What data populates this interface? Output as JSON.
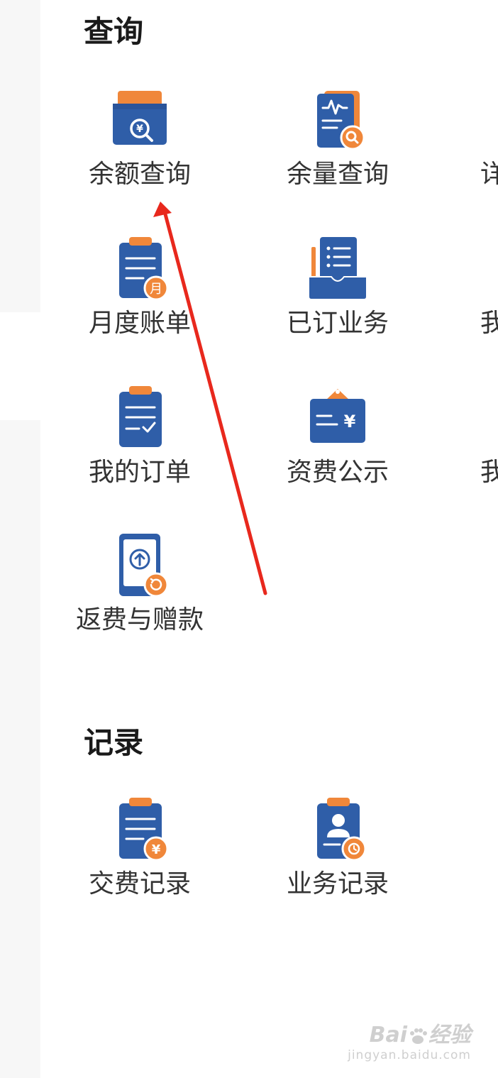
{
  "sections": [
    {
      "title": "查询"
    },
    {
      "title": "记录"
    }
  ],
  "query_items": [
    {
      "label": "余额查询",
      "icon": "wallet-yuan-search-icon"
    },
    {
      "label": "余量查询",
      "icon": "document-chart-search-icon"
    },
    {
      "label": "详",
      "icon": "cut-off-icon"
    },
    {
      "label": "月度账单",
      "icon": "monthly-bill-icon"
    },
    {
      "label": "已订业务",
      "icon": "subscribed-tray-icon"
    },
    {
      "label": "我",
      "icon": "cut-off-icon"
    },
    {
      "label": "我的订单",
      "icon": "order-check-icon"
    },
    {
      "label": "资费公示",
      "icon": "tariff-tag-icon"
    },
    {
      "label": "我",
      "icon": "cut-off-icon"
    },
    {
      "label": "返费与赠款",
      "icon": "phone-refund-icon"
    }
  ],
  "record_items": [
    {
      "label": "交费记录",
      "icon": "payment-record-icon"
    },
    {
      "label": "业务记录",
      "icon": "business-record-icon"
    }
  ],
  "watermark": {
    "brand_left": "Bai",
    "brand_right": "经验",
    "url": "jingyan.baidu.com"
  },
  "colors": {
    "icon_blue": "#2f5ea8",
    "icon_orange": "#f0873a",
    "arrow_red": "#e8281d"
  }
}
